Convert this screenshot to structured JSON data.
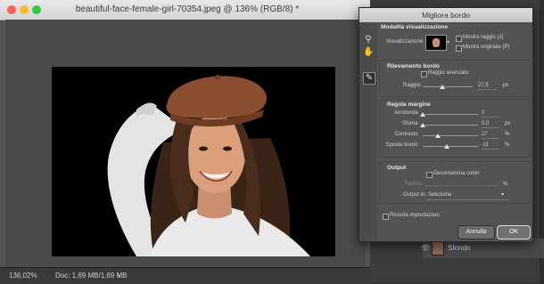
{
  "window": {
    "title": "beautiful-face-female-girl-70354.jpeg @ 136% (RGB/8) *",
    "zoom": "136,02%",
    "doc_info": "Doc: 1,69 MB/1,69 MB",
    "status_arrow": "›"
  },
  "dialog": {
    "title": "Migliora bordo",
    "view_mode": {
      "header": "Modalità visualizzazione",
      "view_label": "Visualizzazione:",
      "show_radius": "Mostra raggio (J)",
      "show_original": "Mostra originale (P)"
    },
    "edge_detection": {
      "header": "Rilevamento bordo",
      "smart_radius": "Raggio avanzato",
      "radius_label": "Raggio:",
      "radius_value": "27,5",
      "radius_unit": "px",
      "radius_level": 0.4
    },
    "adjust_edge": {
      "header": "Regola margine",
      "rows": [
        {
          "label": "Arrotonda:",
          "value": "0",
          "unit": "",
          "level": 0.0
        },
        {
          "label": "Sfuma:",
          "value": "0,0",
          "unit": "px",
          "level": 0.0
        },
        {
          "label": "Contrasto:",
          "value": "27",
          "unit": "%",
          "level": 0.27
        },
        {
          "label": "Sposta bordo:",
          "value": "-11",
          "unit": "%",
          "level": 0.44
        }
      ]
    },
    "output": {
      "header": "Output",
      "decontaminate": "Decontamina colori",
      "amount_label": "Fattore:",
      "amount_unit": "%",
      "output_to_label": "Output in:",
      "output_to_value": "Selezione"
    },
    "remember": "Ricorda impostazioni",
    "cancel": "Annulla",
    "ok": "OK"
  },
  "layers": {
    "layer_name": "Sfondo"
  },
  "colors": {
    "accent": "#4a90e2",
    "close": "#fc5f57",
    "minimize": "#fdbb2e",
    "zoom": "#33c748"
  },
  "icons": [
    "zoom-tool-icon",
    "hand-tool-icon",
    "refine-brush-icon",
    "eye-icon",
    "chevron-down-icon"
  ]
}
